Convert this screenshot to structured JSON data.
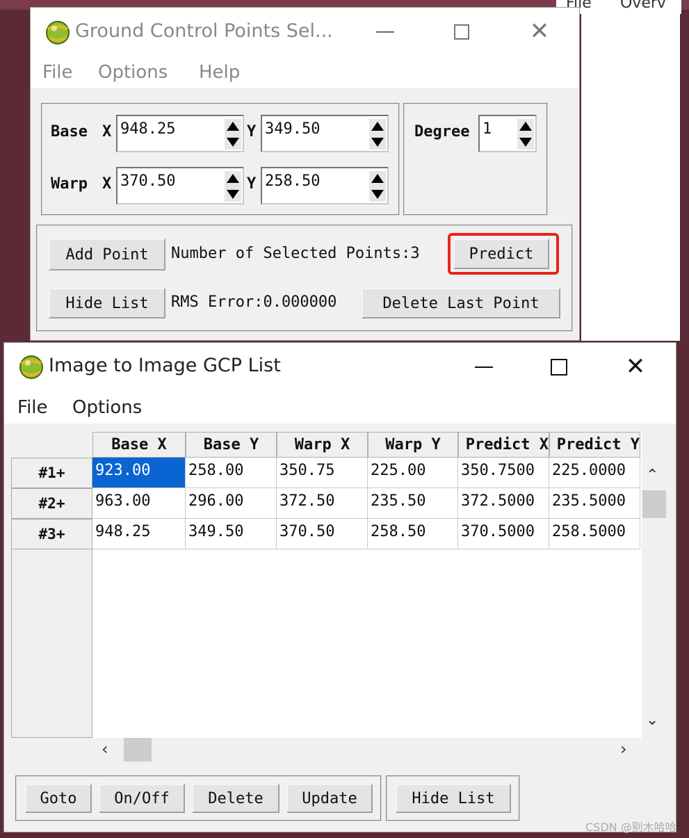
{
  "colors": {
    "highlight_box": "#e8231c",
    "selection": "#0a64d2"
  },
  "gcp_window": {
    "title": "Ground Control Points Sel...",
    "menu": [
      "File",
      "Options",
      "Help"
    ],
    "base_label": "Base",
    "warp_label": "Warp",
    "x_label": "X",
    "y_label": "Y",
    "base_x": "948.25",
    "base_y": "349.50",
    "warp_x": "370.50",
    "warp_y": "258.50",
    "degree_label": "Degree",
    "degree_value": "1",
    "add_point": "Add Point",
    "selected_points_text": "Number of Selected Points:3",
    "predict": "Predict",
    "hide_list": "Hide List",
    "rms_text": "RMS Error:0.000000",
    "delete_last_point": "Delete Last Point"
  },
  "list_window": {
    "title": "Image to Image GCP List",
    "menu": [
      "File",
      "Options"
    ],
    "columns": [
      "Base X",
      "Base Y",
      "Warp X",
      "Warp Y",
      "Predict X",
      "Predict Y"
    ],
    "rows": [
      {
        "label": "#1+",
        "cells": [
          "923.00",
          "258.00",
          "350.75",
          "225.00",
          "350.7500",
          "225.0000"
        ]
      },
      {
        "label": "#2+",
        "cells": [
          "963.00",
          "296.00",
          "372.50",
          "235.50",
          "372.5000",
          "235.5000"
        ]
      },
      {
        "label": "#3+",
        "cells": [
          "948.25",
          "349.50",
          "370.50",
          "258.50",
          "370.5000",
          "258.5000"
        ]
      }
    ],
    "buttons": [
      "Goto",
      "On/Off",
      "Delete",
      "Update"
    ],
    "hide_list": "Hide List"
  },
  "background_menu": [
    "File",
    "Overv"
  ],
  "watermark": "CSDN @别木哈哈"
}
